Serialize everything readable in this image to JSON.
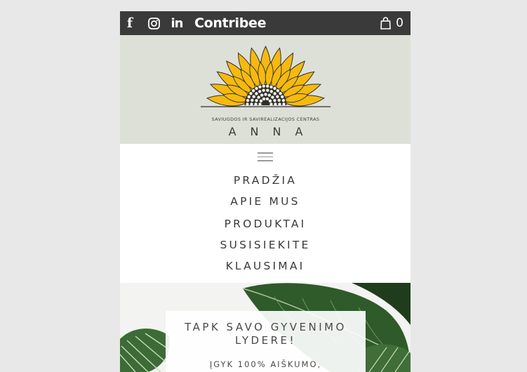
{
  "topbar": {
    "social": [
      "facebook-icon",
      "instagram-icon",
      "linkedin-icon"
    ],
    "facebook_glyph": "f",
    "linkedin_glyph": "in",
    "brand": "Contribee",
    "cart_count": "0",
    "background": "#3a3a3a"
  },
  "logo": {
    "subtitle": "SAVIUGDOS IR SAVIREALIZACIJOS CENTRAS",
    "name": "ANNA",
    "petal_color": "#f5b90f",
    "center_color": "#2f2f2f"
  },
  "nav": {
    "items": [
      "PRADŽIA",
      "APIE MUS",
      "PRODUKTAI",
      "SUSISIEKITE",
      "KLAUSIMAI"
    ]
  },
  "hero": {
    "title": "TAPK SAVO GYVENIMO LYDERE!",
    "subtitle": "ĮGYK 100% AIŠKUMO,"
  }
}
